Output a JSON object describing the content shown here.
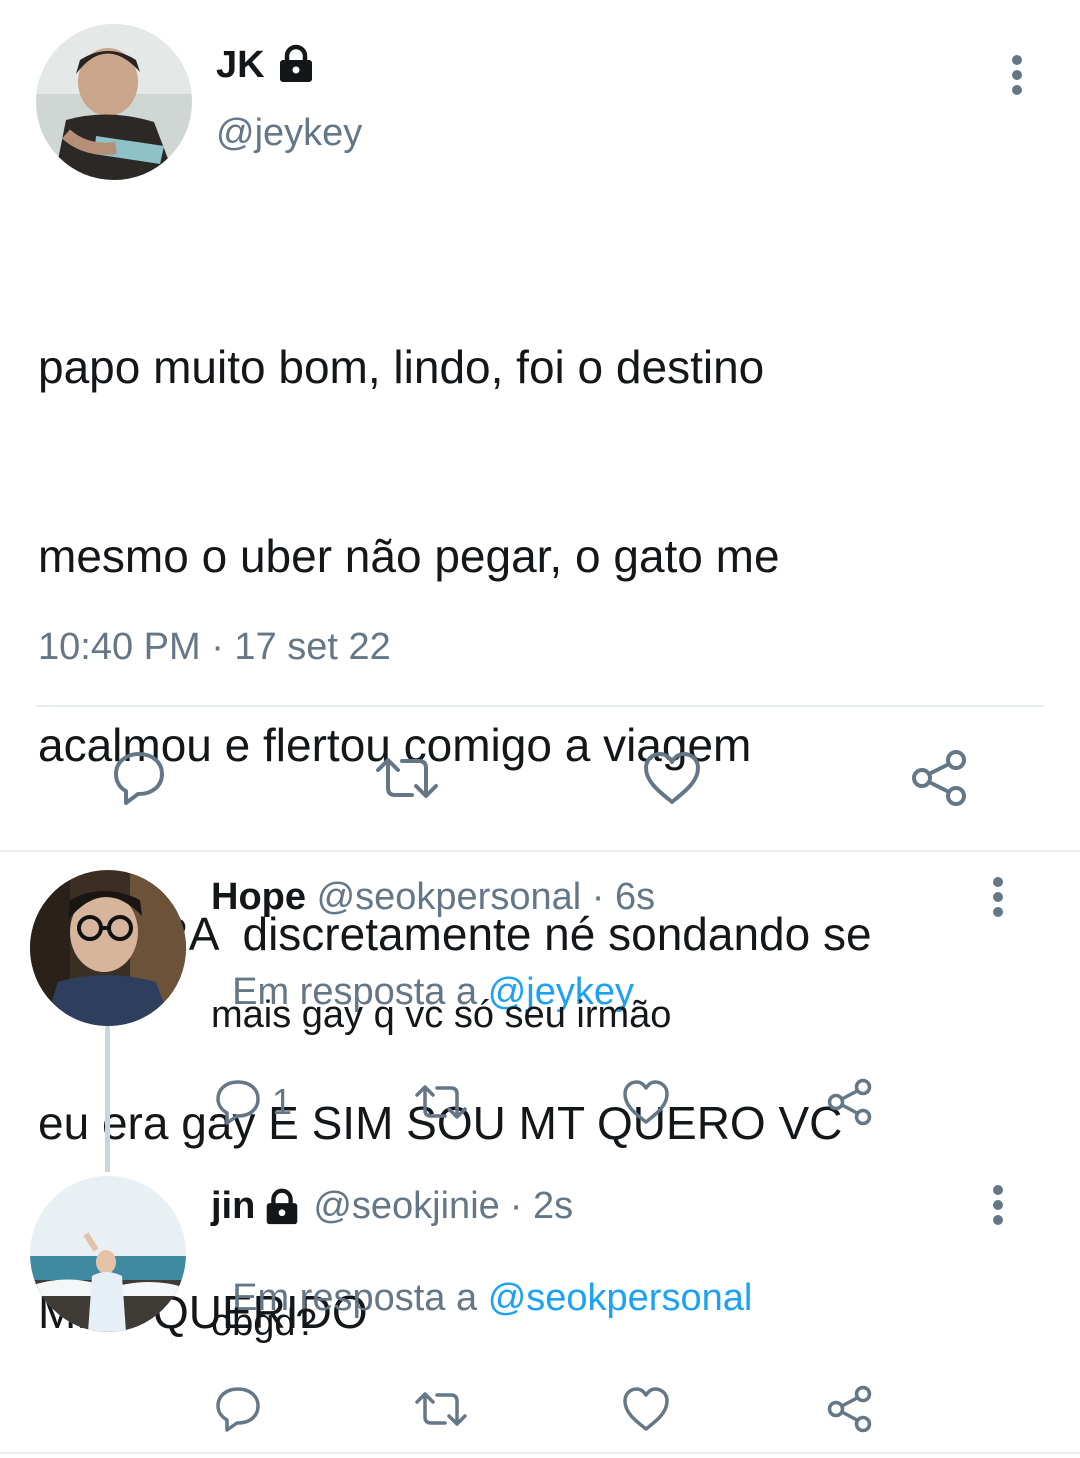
{
  "main_tweet": {
    "author_name": "JK",
    "author_handle": "@jeykey",
    "author_protected_icon": "lock-icon",
    "text_lines": [
      "papo muito bom, lindo, foi o destino",
      "mesmo o uber não pegar, o gato me",
      "acalmou e flertou comigo a viagem",
      "INTEIRA  discretamente né sondando se",
      "eu era gay E SIM SOU MT QUERO VC",
      "MEU QUERIDO"
    ],
    "timestamp": "10:40 PM · 17 set 22",
    "actions": [
      "reply-icon",
      "retweet-icon",
      "like-icon",
      "share-icon"
    ]
  },
  "replies": [
    {
      "author_name": "Hope",
      "author_handle": "@seokpersonal",
      "time": "· 6s",
      "reply_to_prefix": "Em resposta a ",
      "reply_to_handle": "@jeykey",
      "text": "mais gay q vc só seu irmão",
      "reply_count": "1"
    },
    {
      "author_name": "jin",
      "author_handle": "@seokjinie",
      "time": "· 2s",
      "reply_to_prefix": "Em resposta a ",
      "reply_to_handle": "@seokpersonal",
      "text": "obgd?",
      "reply_count": ""
    }
  ],
  "colors": {
    "accent": "#1da1f2",
    "muted": "#657786",
    "divider": "#e6ecf0"
  }
}
